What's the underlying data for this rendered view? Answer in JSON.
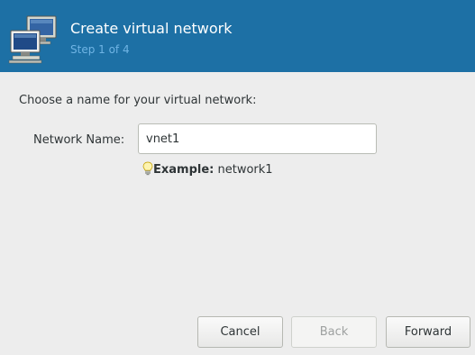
{
  "header": {
    "title": "Create virtual network",
    "step": "Step 1 of 4",
    "icon": "network-computers-icon"
  },
  "main": {
    "prompt": "Choose a name for your virtual network:",
    "network_name_label": "Network Name:",
    "network_name_value": "vnet1",
    "hint_icon": "lightbulb-icon",
    "hint_bold": "Example:",
    "hint_text": " network1"
  },
  "buttons": {
    "cancel": "Cancel",
    "back": "Back",
    "forward": "Forward"
  },
  "colors": {
    "header_bg": "#1d70a5",
    "header_step": "#6fb4e4"
  }
}
